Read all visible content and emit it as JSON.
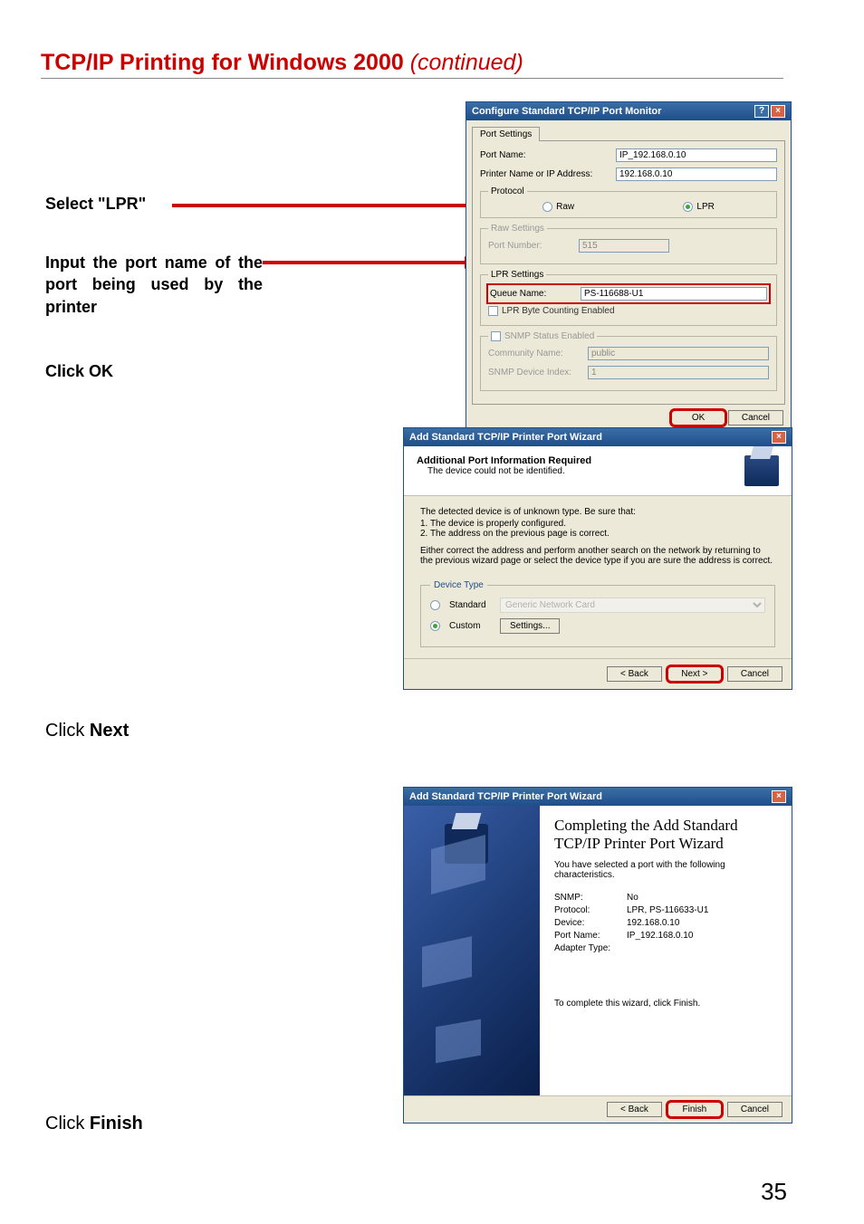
{
  "page": {
    "title_prefix": "TCP/IP Printing for Windows 2000",
    "title_suffix": " (continued)",
    "number": "35"
  },
  "instructions": {
    "select_lpr": "Select \"LPR\"",
    "input_port": "Input the port name of the port being used by the printer",
    "click_ok_a": "Click ",
    "click_ok_b": "OK",
    "click_next_a": "Click ",
    "click_next_b": "Next",
    "click_finish_a": "Click ",
    "click_finish_b": "Finish"
  },
  "dlg1": {
    "title": "Configure Standard TCP/IP Port Monitor",
    "tab": "Port Settings",
    "port_name_label": "Port Name:",
    "port_name_value": "IP_192.168.0.10",
    "printer_addr_label": "Printer Name or IP Address:",
    "printer_addr_value": "192.168.0.10",
    "protocol_legend": "Protocol",
    "raw": "Raw",
    "lpr": "LPR",
    "raw_legend": "Raw Settings",
    "raw_port_label": "Port Number:",
    "raw_port_value": "515",
    "lpr_legend": "LPR Settings",
    "queue_label": "Queue Name:",
    "queue_value": "PS-116688-U1",
    "lpr_byte": "LPR Byte Counting Enabled",
    "snmp_enabled": "SNMP Status Enabled",
    "community_label": "Community Name:",
    "community_value": "public",
    "snmp_index_label": "SNMP Device Index:",
    "snmp_index_value": "1",
    "ok": "OK",
    "cancel": "Cancel"
  },
  "dlg2": {
    "title": "Add Standard TCP/IP Printer Port Wizard",
    "hdr_title": "Additional Port Information Required",
    "hdr_sub": "The device could not be identified.",
    "body_l1": "The detected device is of unknown type. Be sure that:",
    "body_l2": "1. The device is properly configured.",
    "body_l3": "2. The address on the previous page is correct.",
    "body_p2": "Either correct the address and perform another search on the network by returning to the previous wizard page or select the device type if you are sure the address is correct.",
    "devtype_legend": "Device Type",
    "standard": "Standard",
    "standard_val": "Generic Network Card",
    "custom": "Custom",
    "settings": "Settings...",
    "back": "< Back",
    "next": "Next >",
    "cancel": "Cancel"
  },
  "dlg3": {
    "title": "Add Standard TCP/IP Printer Port Wizard",
    "heading": "Completing the Add Standard TCP/IP Printer Port Wizard",
    "intro": "You have selected a port with the following characteristics.",
    "rows": {
      "snmp_k": "SNMP:",
      "snmp_v": "No",
      "proto_k": "Protocol:",
      "proto_v": "LPR, PS-116633-U1",
      "dev_k": "Device:",
      "dev_v": "192.168.0.10",
      "port_k": "Port Name:",
      "port_v": "IP_192.168.0.10",
      "adapter_k": "Adapter Type:",
      "adapter_v": ""
    },
    "footer": "To complete this wizard, click Finish.",
    "back": "< Back",
    "finish": "Finish",
    "cancel": "Cancel"
  }
}
